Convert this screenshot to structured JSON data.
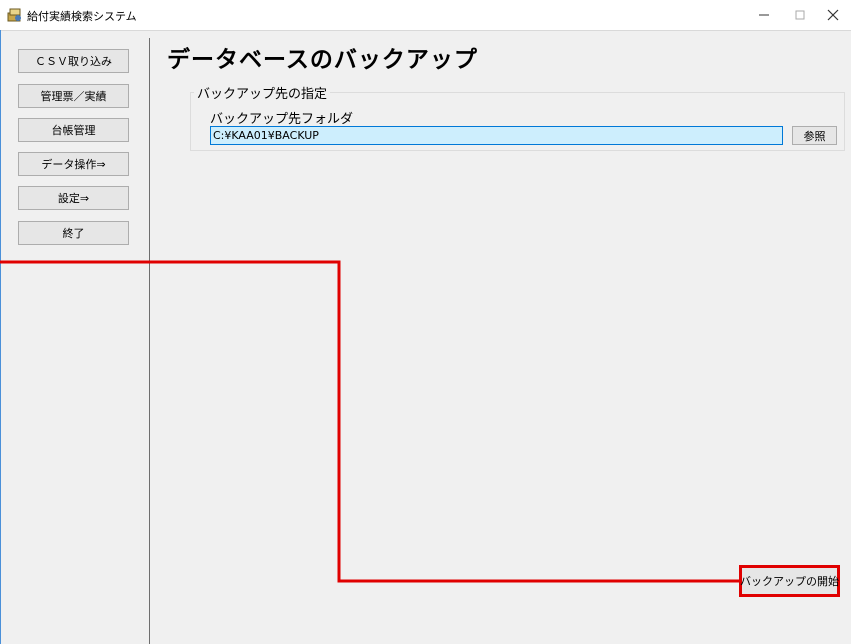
{
  "window": {
    "title": "給付実績検索システム",
    "app_icon": "app-icon",
    "controls": [
      "minimize-icon",
      "maximize-icon",
      "close-icon"
    ]
  },
  "sidebar": {
    "items": [
      {
        "label": "ＣＳＶ取り込み"
      },
      {
        "label": "管理票／実績"
      },
      {
        "label": "台帳管理"
      },
      {
        "label": "データ操作⇒"
      },
      {
        "label": "設定⇒"
      },
      {
        "label": "終了"
      }
    ]
  },
  "main": {
    "page_title": "データベースのバックアップ",
    "group": {
      "legend": "バックアップ先の指定",
      "field_label": "バックアップ先フォルダ",
      "folder_value": "C:¥KAA01¥BACKUP",
      "browse_label": "参照"
    },
    "start_button_label": "バックアップの開始"
  },
  "colors": {
    "highlight": "#e00000",
    "input_background": "#cdeefd",
    "input_border": "#0078d7",
    "window_background": "#f0f0f0"
  }
}
